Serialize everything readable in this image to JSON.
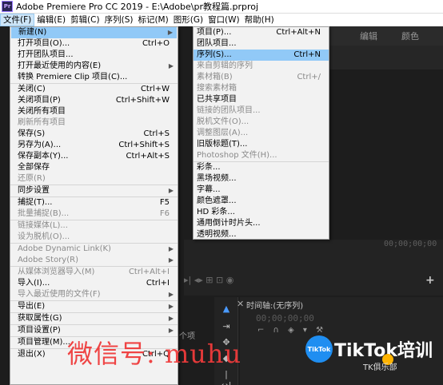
{
  "window": {
    "title": "Adobe Premiere Pro CC 2019 - E:\\Adobe\\pr教程篇.prproj",
    "logo": "Pr"
  },
  "menubar": [
    "文件(F)",
    "编辑(E)",
    "剪辑(C)",
    "序列(S)",
    "标记(M)",
    "图形(G)",
    "窗口(W)",
    "帮助(H)"
  ],
  "panel_tabs": [
    "编辑",
    "颜色"
  ],
  "file_menu": [
    {
      "label": "新建(N)",
      "arrow": true,
      "hl": true
    },
    {
      "label": "打开项目(O)...",
      "shortcut": "Ctrl+O"
    },
    {
      "label": "打开团队项目..."
    },
    {
      "label": "打开最近使用的内容(E)",
      "arrow": true
    },
    {
      "label": "转换 Premiere Clip 项目(C)..."
    },
    {
      "sep": true
    },
    {
      "label": "关闭(C)",
      "shortcut": "Ctrl+W"
    },
    {
      "label": "关闭项目(P)",
      "shortcut": "Ctrl+Shift+W"
    },
    {
      "label": "关闭所有项目"
    },
    {
      "label": "刷新所有项目",
      "disabled": true
    },
    {
      "label": "保存(S)",
      "shortcut": "Ctrl+S"
    },
    {
      "label": "另存为(A)...",
      "shortcut": "Ctrl+Shift+S"
    },
    {
      "label": "保存副本(Y)...",
      "shortcut": "Ctrl+Alt+S"
    },
    {
      "label": "全部保存"
    },
    {
      "label": "还原(R)",
      "disabled": true
    },
    {
      "sep": true
    },
    {
      "label": "同步设置",
      "arrow": true
    },
    {
      "sep": true
    },
    {
      "label": "捕捉(T)...",
      "shortcut": "F5"
    },
    {
      "label": "批量捕捉(B)...",
      "shortcut": "F6",
      "disabled": true
    },
    {
      "sep": true
    },
    {
      "label": "链接媒体(L)...",
      "disabled": true
    },
    {
      "label": "设为脱机(O)...",
      "disabled": true
    },
    {
      "sep": true
    },
    {
      "label": "Adobe Dynamic Link(K)",
      "arrow": true,
      "disabled": true
    },
    {
      "label": "Adobe Story(R)",
      "arrow": true,
      "disabled": true
    },
    {
      "sep": true
    },
    {
      "label": "从媒体浏览器导入(M)",
      "shortcut": "Ctrl+Alt+I",
      "disabled": true
    },
    {
      "label": "导入(I)...",
      "shortcut": "Ctrl+I"
    },
    {
      "label": "导入最近使用的文件(F)",
      "arrow": true,
      "disabled": true
    },
    {
      "sep": true
    },
    {
      "label": "导出(E)",
      "arrow": true
    },
    {
      "sep": true
    },
    {
      "label": "获取属性(G)",
      "arrow": true
    },
    {
      "sep": true
    },
    {
      "label": "项目设置(P)",
      "arrow": true
    },
    {
      "sep": true
    },
    {
      "label": "项目管理(M)..."
    },
    {
      "sep": true
    },
    {
      "label": "退出(X)",
      "shortcut": "Ctrl+Q"
    }
  ],
  "new_submenu": [
    {
      "label": "项目(P)...",
      "shortcut": "Ctrl+Alt+N"
    },
    {
      "label": "团队项目..."
    },
    {
      "label": "序列(S)...",
      "shortcut": "Ctrl+N",
      "hl": true
    },
    {
      "label": "来自剪辑的序列",
      "disabled": true
    },
    {
      "label": "素材箱(B)",
      "shortcut": "Ctrl+/",
      "disabled": true
    },
    {
      "label": "搜索素材箱",
      "disabled": true
    },
    {
      "label": "已共享项目"
    },
    {
      "label": "链接的团队项目...",
      "disabled": true
    },
    {
      "label": "脱机文件(O)...",
      "disabled": true
    },
    {
      "label": "调整图层(A)...",
      "disabled": true
    },
    {
      "label": "旧版标题(T)..."
    },
    {
      "label": "Photoshop 文件(H)...",
      "disabled": true
    },
    {
      "sep": true
    },
    {
      "label": "彩条..."
    },
    {
      "label": "黑场视频..."
    },
    {
      "label": "字幕..."
    },
    {
      "label": "颜色遮罩..."
    },
    {
      "label": "HD 彩条..."
    },
    {
      "label": "通用倒计时片头..."
    },
    {
      "label": "透明视频..."
    }
  ],
  "monitor": {
    "timecode": "00;00;00;00",
    "controls": "▸| ◂▸ ⊞ ⊡ ◉"
  },
  "timeline": {
    "title": "时间轴:(无序列)",
    "timecode": "00;00;00;00",
    "close": "✕",
    "items_label": "个项"
  },
  "watermark": {
    "left_text": "微信号: muhu",
    "right_text": "TikTok培训",
    "badge": "TikTok",
    "sub": "TK俱乐部"
  },
  "accent_color": "#91c9f7",
  "watermark_color": "#ef3b3b"
}
